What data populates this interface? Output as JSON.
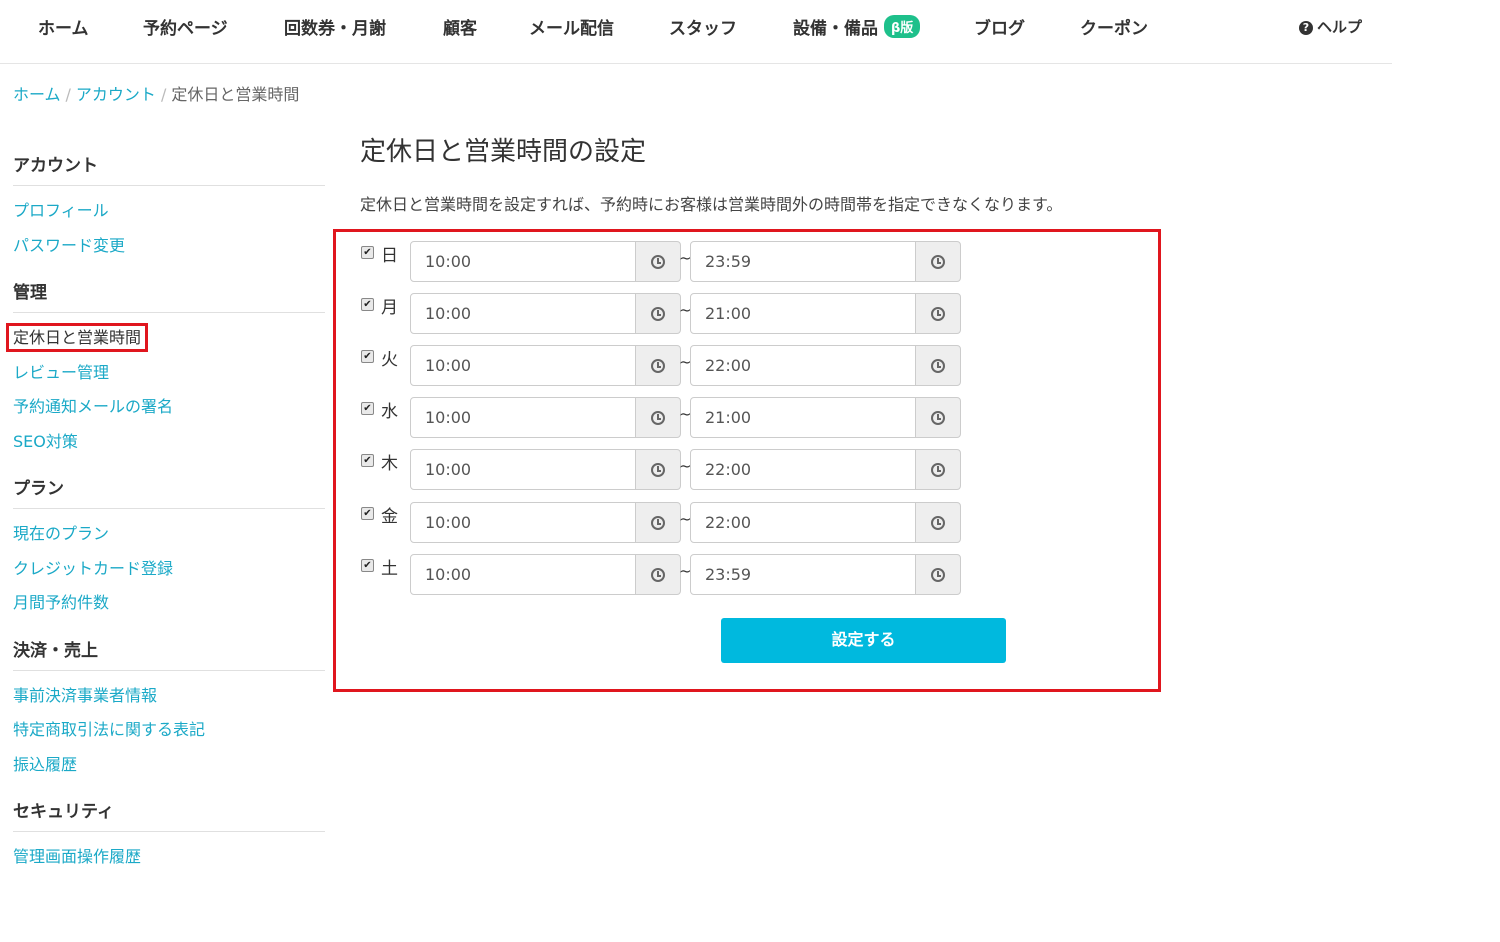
{
  "nav": {
    "items": [
      "ホーム",
      "予約ページ",
      "回数券・月謝",
      "顧客",
      "メール配信",
      "スタッフ",
      "設備・備品",
      "ブログ",
      "クーポン"
    ],
    "beta_badge": "β版",
    "help": "ヘルプ"
  },
  "breadcrumb": [
    "ホーム",
    "アカウント",
    "定休日と営業時間"
  ],
  "sidebar": {
    "sections": [
      {
        "title": "アカウント",
        "links": [
          "プロフィール",
          "パスワード変更"
        ]
      },
      {
        "title": "管理",
        "links": [
          "定休日と営業時間",
          "レビュー管理",
          "予約通知メールの署名",
          "SEO対策"
        ]
      },
      {
        "title": "プラン",
        "links": [
          "現在のプラン",
          "クレジットカード登録",
          "月間予約件数"
        ]
      },
      {
        "title": "決済・売上",
        "links": [
          "事前決済事業者情報",
          "特定商取引法に関する表記",
          "振込履歴"
        ]
      },
      {
        "title": "セキュリティ",
        "links": [
          "管理画面操作履歴"
        ]
      }
    ]
  },
  "main": {
    "title": "定休日と営業時間の設定",
    "description": "定休日と営業時間を設定すれば、予約時にお客様は営業時間外の時間帯を指定できなくなります。",
    "tilde": "~",
    "rows": [
      {
        "day": "日",
        "checked": true,
        "start": "10:00",
        "end": "23:59"
      },
      {
        "day": "月",
        "checked": true,
        "start": "10:00",
        "end": "21:00"
      },
      {
        "day": "火",
        "checked": true,
        "start": "10:00",
        "end": "22:00"
      },
      {
        "day": "水",
        "checked": true,
        "start": "10:00",
        "end": "21:00"
      },
      {
        "day": "木",
        "checked": true,
        "start": "10:00",
        "end": "22:00"
      },
      {
        "day": "金",
        "checked": true,
        "start": "10:00",
        "end": "22:00"
      },
      {
        "day": "土",
        "checked": true,
        "start": "10:00",
        "end": "23:59"
      }
    ],
    "submit_label": "設定する"
  },
  "colors": {
    "link": "#1ba9c7",
    "accent": "#00b9de",
    "highlight": "#e0161e",
    "beta": "#1ec08b"
  }
}
